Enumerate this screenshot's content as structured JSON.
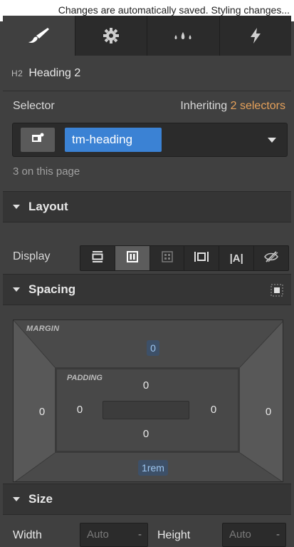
{
  "topbar": {
    "text": "Changes are automatically saved. Styling changes..."
  },
  "tabs": [
    {
      "icon": "paintbrush-icon",
      "active": true
    },
    {
      "icon": "gear-icon",
      "active": false
    },
    {
      "icon": "drops-icon",
      "active": false
    },
    {
      "icon": "lightning-icon",
      "active": false
    }
  ],
  "element": {
    "badge": "H2",
    "name": "Heading 2"
  },
  "selector": {
    "label": "Selector",
    "inheriting_prefix": "Inheriting",
    "inheriting_count": "2 selectors",
    "chip": "tm-heading",
    "on_page": "3 on this page"
  },
  "layout": {
    "title": "Layout",
    "display_label": "Display",
    "display_options": [
      "block",
      "flex",
      "grid",
      "inline-block",
      "inline",
      "none"
    ],
    "display_active": "flex",
    "inline_glyph": "|A|"
  },
  "spacing": {
    "title": "Spacing",
    "margin_label": "MARGIN",
    "padding_label": "PADDING",
    "margin_top": "0",
    "margin_left": "0",
    "margin_right": "0",
    "margin_bottom": "1rem",
    "padding_top": "0",
    "padding_left": "0",
    "padding_right": "0",
    "padding_bottom": "0"
  },
  "size": {
    "title": "Size",
    "width_label": "Width",
    "width_placeholder": "Auto",
    "height_label": "Height",
    "height_placeholder": "Auto",
    "unit_dash": "-"
  },
  "colors": {
    "accent": "#3b82d4",
    "inheriting": "#e6a15a",
    "panel": "#404040"
  }
}
